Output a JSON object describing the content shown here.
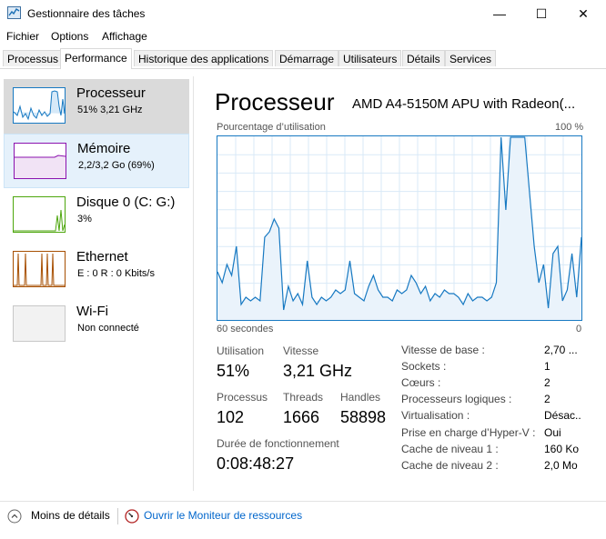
{
  "window": {
    "title": "Gestionnaire des tâches",
    "minimize": "—",
    "maximize": "☐",
    "close": "✕"
  },
  "menu": [
    "Fichier",
    "Options",
    "Affichage"
  ],
  "tabs": [
    {
      "label": "Processus"
    },
    {
      "label": "Performance"
    },
    {
      "label": "Historique des applications"
    },
    {
      "label": "Démarrage"
    },
    {
      "label": "Utilisateurs"
    },
    {
      "label": "Détails"
    },
    {
      "label": "Services"
    }
  ],
  "sidebar": [
    {
      "title": "Processeur",
      "subtitle": "51% 3,21 GHz"
    },
    {
      "title": "Mémoire",
      "subtitle": "2,2/3,2 Go (69%)"
    },
    {
      "title": "Disque 0 (C: G:)",
      "subtitle": "3%"
    },
    {
      "title": "Ethernet",
      "subtitle": "E : 0 R : 0 Kbits/s"
    },
    {
      "title": "Wi-Fi",
      "subtitle": "Non connecté"
    }
  ],
  "main": {
    "title": "Processeur",
    "cpu_name": "AMD A4-5150M APU with Radeon(...",
    "graph_top_left": "Pourcentage d’utilisation",
    "graph_top_right": "100 %",
    "graph_bottom_left": "60 secondes",
    "graph_bottom_right": "0"
  },
  "stats": {
    "utilisation_label": "Utilisation",
    "utilisation_value": "51%",
    "vitesse_label": "Vitesse",
    "vitesse_value": "3,21 GHz",
    "processus_label": "Processus",
    "processus_value": "102",
    "threads_label": "Threads",
    "threads_value": "1666",
    "handles_label": "Handles",
    "handles_value": "58898",
    "uptime_label": "Durée de fonctionnement",
    "uptime_value": "0:08:48:27"
  },
  "details": [
    {
      "key": "Vitesse de base :",
      "value": "2,70 ..."
    },
    {
      "key": "Sockets :",
      "value": "1"
    },
    {
      "key": "Cœurs :",
      "value": "2"
    },
    {
      "key": "Processeurs logiques :",
      "value": "2"
    },
    {
      "key": "Virtualisation :",
      "value": "Désac..."
    },
    {
      "key": "Prise en charge d’Hyper-V :",
      "value": "Oui"
    },
    {
      "key": "Cache de niveau 1 :",
      "value": "160 Ko"
    },
    {
      "key": "Cache de niveau 2 :",
      "value": "2,0 Mo"
    }
  ],
  "footer": {
    "less_details": "Moins de détails",
    "resource_monitor": "Ouvrir le Moniteur de ressources"
  },
  "colors": {
    "cpu_accent": "#1779c2",
    "memory_accent": "#8b12ae",
    "disk_accent": "#4da60c",
    "ethernet_accent": "#a74f01",
    "link": "#0066cc"
  },
  "chart_data": {
    "type": "area",
    "ylim": [
      0,
      100
    ],
    "values": [
      26,
      20,
      30,
      24,
      40,
      8,
      12,
      10,
      12,
      10,
      45,
      48,
      55,
      50,
      5,
      18,
      10,
      14,
      8,
      32,
      12,
      8,
      12,
      10,
      12,
      16,
      14,
      16,
      32,
      14,
      12,
      10,
      18,
      24,
      16,
      12,
      12,
      10,
      16,
      14,
      16,
      24,
      20,
      14,
      18,
      10,
      14,
      12,
      16,
      14,
      14,
      12,
      8,
      14,
      10,
      12,
      12,
      10,
      12,
      20,
      100,
      60,
      100,
      100,
      100,
      100,
      70,
      40,
      20,
      30,
      6,
      36,
      40,
      10,
      16,
      36,
      12,
      45
    ]
  }
}
